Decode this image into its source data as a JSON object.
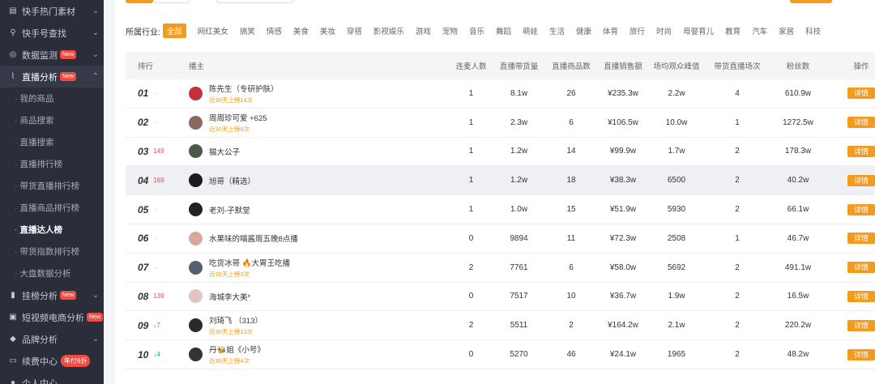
{
  "sidebar": {
    "items": [
      {
        "label": "快手热门素材",
        "icon": "flame-icon"
      },
      {
        "label": "快手号查找",
        "icon": "search-icon"
      },
      {
        "label": "数据监测",
        "icon": "monitor-icon",
        "badge": "New"
      },
      {
        "label": "直播分析",
        "icon": "live-chart-icon",
        "badge": "New"
      }
    ],
    "sub_items": [
      "我的商品",
      "商品搜索",
      "直播搜索",
      "直播排行榜",
      "带货直播排行榜",
      "直播商品排行榜",
      "直播达人榜",
      "带货指数排行榜",
      "大盘数据分析"
    ],
    "current_sub": "直播达人榜",
    "bottom_items": [
      {
        "label": "挂榜分析",
        "icon": "bar-chart-icon",
        "badge": "New"
      },
      {
        "label": "短视频电商分析",
        "icon": "cart-icon",
        "badge": "New"
      },
      {
        "label": "品牌分析",
        "icon": "diamond-icon"
      },
      {
        "label": "续费中心",
        "icon": "wallet-icon",
        "promo": "年付6折"
      },
      {
        "label": "个人中心",
        "icon": "user-icon"
      }
    ]
  },
  "filter": {
    "label": "所属行业:",
    "tags": [
      "全部",
      "网红美女",
      "搞笑",
      "情感",
      "美食",
      "美妆",
      "穿搭",
      "影视娱乐",
      "游戏",
      "宠物",
      "音乐",
      "舞蹈",
      "萌娃",
      "生活",
      "健康",
      "体育",
      "旅行",
      "时尚",
      "母婴育儿",
      "教育",
      "汽车",
      "家居",
      "科技"
    ]
  },
  "table": {
    "headers": [
      "排行",
      "播主",
      "连麦人数",
      "直播带货量",
      "直播商品数",
      "直播销售额",
      "场均观众峰值",
      "带货直播场次",
      "粉丝数",
      "操作"
    ],
    "detail_label": "详情",
    "rows": [
      {
        "rank": "01",
        "change": "--",
        "dir": "none",
        "name": "陈先生（专研护肤）",
        "tag": "近30天上榜14次",
        "lian": "1",
        "vol": "8.1w",
        "cnt": "26",
        "gmv": "¥235.3w",
        "peak": "2.2w",
        "times": "4",
        "fans": "610.9w",
        "avatar": "#c5303b"
      },
      {
        "rank": "02",
        "change": "--",
        "dir": "none",
        "name": "周周珍可爱 +625",
        "tag": "近30天上榜9次",
        "lian": "1",
        "vol": "2.3w",
        "cnt": "6",
        "gmv": "¥106.5w",
        "peak": "10.0w",
        "times": "1",
        "fans": "1272.5w",
        "avatar": "#8a6a5a"
      },
      {
        "rank": "03",
        "change": "149",
        "dir": "up",
        "name": "猫大公子",
        "tag": "",
        "lian": "1",
        "vol": "1.2w",
        "cnt": "14",
        "gmv": "¥99.9w",
        "peak": "1.7w",
        "times": "2",
        "fans": "178.3w",
        "avatar": "#4a5a4a"
      },
      {
        "rank": "04",
        "change": "169",
        "dir": "up",
        "name": "旭哥（精选）",
        "tag": "",
        "lian": "1",
        "vol": "1.2w",
        "cnt": "18",
        "gmv": "¥38.3w",
        "peak": "6500",
        "times": "2",
        "fans": "40.2w",
        "avatar": "#1d1d1d"
      },
      {
        "rank": "05",
        "change": "--",
        "dir": "none",
        "name": "老刘-子默堂",
        "tag": "",
        "lian": "1",
        "vol": "1.0w",
        "cnt": "15",
        "gmv": "¥51.9w",
        "peak": "5930",
        "times": "2",
        "fans": "66.1w",
        "avatar": "#222222"
      },
      {
        "rank": "06",
        "change": "--",
        "dir": "none",
        "name": "水果味的喵酱周五晚8点播",
        "tag": "",
        "lian": "0",
        "vol": "9894",
        "cnt": "11",
        "gmv": "¥72.3w",
        "peak": "2508",
        "times": "1",
        "fans": "46.7w",
        "avatar": "#d9a7a0"
      },
      {
        "rank": "07",
        "change": "--",
        "dir": "none",
        "name": "吃货冰哥 🔥大胃王吃播",
        "tag": "近30天上榜2次",
        "lian": "2",
        "vol": "7761",
        "cnt": "6",
        "gmv": "¥58.0w",
        "peak": "5692",
        "times": "2",
        "fans": "491.1w",
        "avatar": "#56606e"
      },
      {
        "rank": "08",
        "change": "139",
        "dir": "up",
        "name": "海城李大美*",
        "tag": "",
        "lian": "0",
        "vol": "7517",
        "cnt": "10",
        "gmv": "¥36.7w",
        "peak": "1.9w",
        "times": "2",
        "fans": "16.5w",
        "avatar": "#e3c5c0"
      },
      {
        "rank": "09",
        "change": "↓7",
        "dir": "down",
        "name": "刘琦飞 （313）",
        "tag": "近30天上榜13次",
        "lian": "2",
        "vol": "5511",
        "cnt": "2",
        "gmv": "¥164.2w",
        "peak": "2.1w",
        "times": "2",
        "fans": "220.2w",
        "avatar": "#2a2a2a"
      },
      {
        "rank": "10",
        "change": "↓4",
        "dir": "down",
        "name": "丹🐝姐《小号》",
        "tag": "近30天上榜4次",
        "lian": "0",
        "vol": "5270",
        "cnt": "46",
        "gmv": "¥24.1w",
        "peak": "1965",
        "times": "2",
        "fans": "48.2w",
        "avatar": "#333333"
      }
    ]
  }
}
